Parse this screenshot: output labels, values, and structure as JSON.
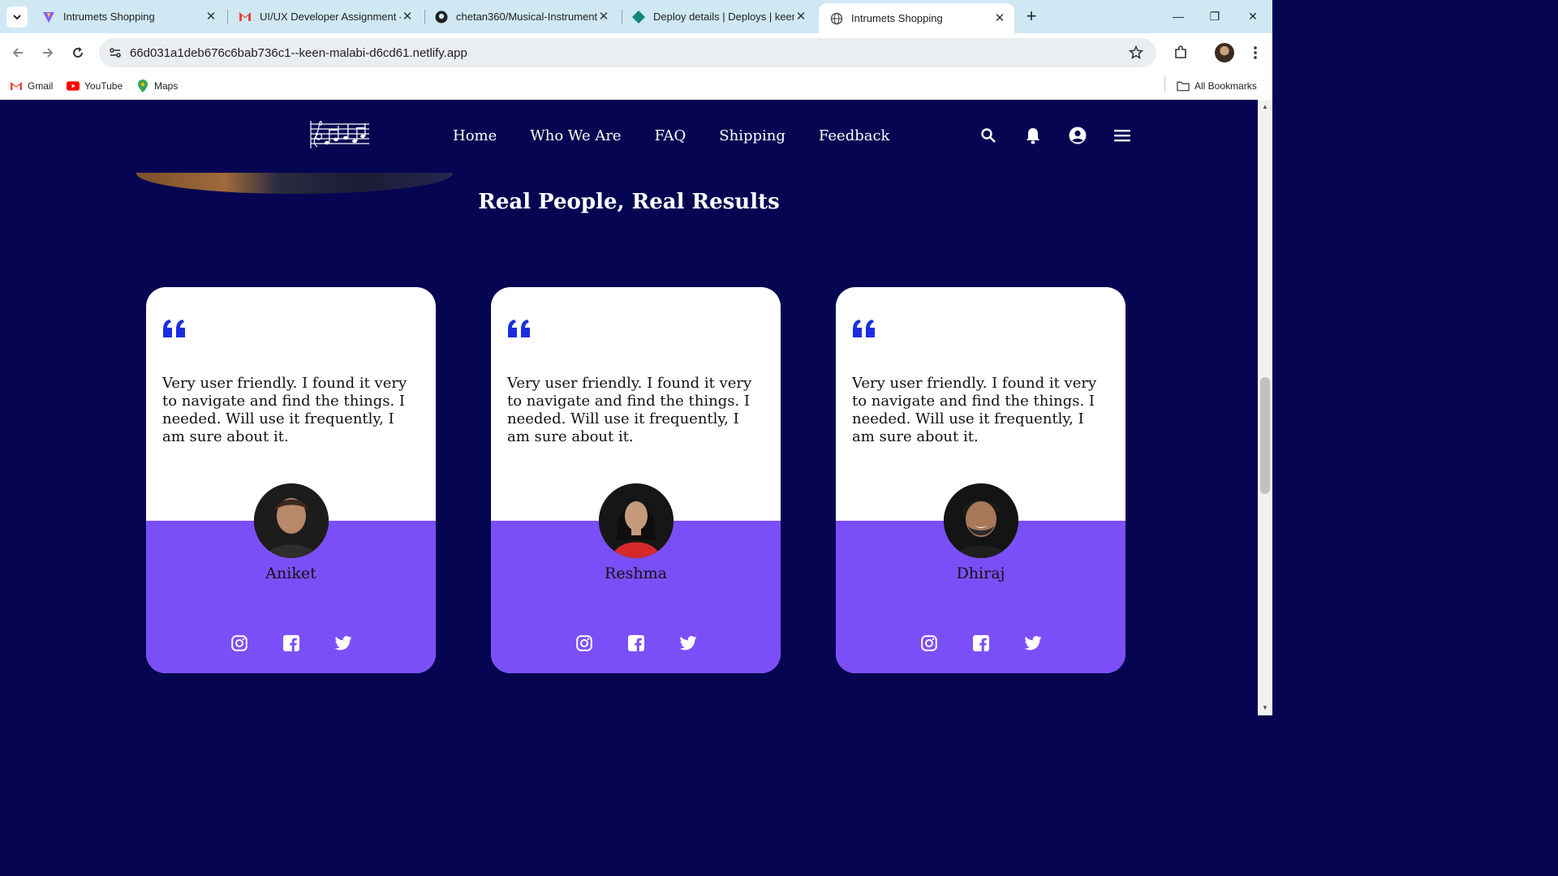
{
  "browser": {
    "tabs": [
      {
        "title": "Intrumets Shopping",
        "active": false
      },
      {
        "title": "UI/UX Developer Assignment -",
        "active": false
      },
      {
        "title": "chetan360/Musical-Instruments",
        "active": false
      },
      {
        "title": "Deploy details | Deploys | keen-",
        "active": false
      },
      {
        "title": "Intrumets Shopping",
        "active": true
      }
    ],
    "url": "66d031a1deb676c6bab736c1--keen-malabi-d6cd61.netlify.app",
    "bookmarks": [
      "Gmail",
      "YouTube",
      "Maps"
    ],
    "all_bookmarks": "All Bookmarks"
  },
  "site": {
    "nav": [
      "Home",
      "Who We Are",
      "FAQ",
      "Shipping",
      "Feedback"
    ],
    "section_title": "Real People, Real Results",
    "testimonials": [
      {
        "text": "Very user friendly. I found it very to navigate and find the things. I needed. Will use it frequently, I am sure about it.",
        "name": "Aniket"
      },
      {
        "text": "Very user friendly. I found it very to navigate and find the things. I needed. Will use it frequently, I am sure about it.",
        "name": "Reshma"
      },
      {
        "text": "Very user friendly. I found it very to navigate and find the things. I needed. Will use it frequently, I am sure about it.",
        "name": "Dhiraj"
      }
    ]
  },
  "colors": {
    "page_bg": "#050552",
    "card_accent": "#7b4ff7",
    "quote_blue": "#1a2ee0"
  }
}
